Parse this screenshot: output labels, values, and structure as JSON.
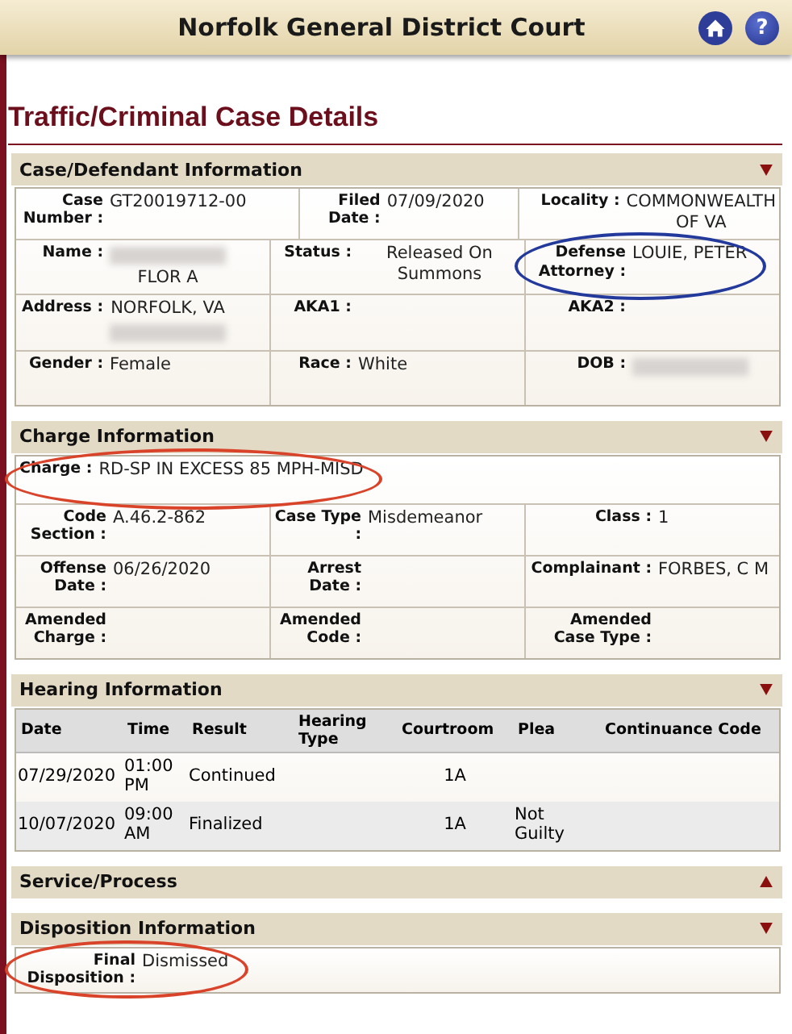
{
  "header": {
    "title": "Norfolk General District Court",
    "help_icon": "?"
  },
  "page_title": "Traffic/Criminal Case Details",
  "sections": [
    {
      "kind": "fields",
      "title": "Case/Defendant Information",
      "expanded": true,
      "rows": [
        [
          {
            "label": "Case Number :",
            "value": "GT20019712-00"
          },
          {
            "label": "Filed Date :",
            "value": "07/09/2020"
          },
          {
            "label": "Locality :",
            "value": "COMMONWEALTH OF VA"
          }
        ],
        [
          {
            "label": "Name :",
            "parts": [
              {
                "kind": "blurred"
              },
              {
                "kind": "text",
                "text": "FLOR A"
              }
            ]
          },
          {
            "label": "Status :",
            "value": "Released On Summons"
          },
          {
            "label": "Defense Attorney :",
            "value": "LOUIE, PETER",
            "color": "#23399c"
          }
        ],
        [
          {
            "label": "Address :",
            "parts": [
              {
                "kind": "text",
                "text": "NORFOLK, VA"
              },
              {
                "kind": "blurred"
              }
            ]
          },
          {
            "label": "AKA1 :"
          },
          {
            "label": "AKA2 :"
          }
        ],
        [
          {
            "label": "Gender :",
            "value": "Female"
          },
          {
            "label": "Race :",
            "value": "White"
          },
          {
            "label": "DOB :",
            "parts": [
              {
                "kind": "blurred"
              }
            ]
          }
        ]
      ]
    },
    {
      "kind": "fields",
      "title": "Charge Information",
      "expanded": true,
      "rows": [
        [
          {
            "label": "Charge :",
            "value": "RD-SP IN EXCESS 85 MPH-MISD",
            "color": "#d8432a"
          }
        ],
        [
          {
            "label": "Code Section :",
            "value": "A.46.2-862"
          },
          {
            "label": "Case Type :",
            "value": "Misdemeanor"
          },
          {
            "label": "Class :",
            "value": "1"
          }
        ],
        [
          {
            "label": "Offense Date :",
            "value": "06/26/2020"
          },
          {
            "label": "Arrest Date :"
          },
          {
            "label": "Complainant :",
            "value": "FORBES, C M"
          }
        ],
        [
          {
            "label": "Amended Charge :"
          },
          {
            "label": "Amended Code :"
          },
          {
            "label": "Amended Case Type :"
          }
        ]
      ]
    },
    {
      "kind": "table",
      "title": "Hearing Information",
      "expanded": true,
      "columns": [
        "Date",
        "Time",
        "Result",
        "Hearing Type",
        "Courtroom",
        "Plea",
        "Continuance Code"
      ],
      "rows": [
        [
          "07/29/2020",
          "01:00 PM",
          "Continued",
          "",
          "1A",
          "",
          ""
        ],
        [
          "10/07/2020",
          "09:00 AM",
          "Finalized",
          "",
          "1A",
          "Not Guilty",
          ""
        ]
      ]
    },
    {
      "title": "Service/Process",
      "expanded": false
    },
    {
      "kind": "fields",
      "title": "Disposition Information",
      "expanded": true,
      "rows": [
        [
          {
            "label": "Final Disposition :",
            "value": "Dismissed",
            "color": "#d8432a"
          }
        ]
      ]
    }
  ]
}
